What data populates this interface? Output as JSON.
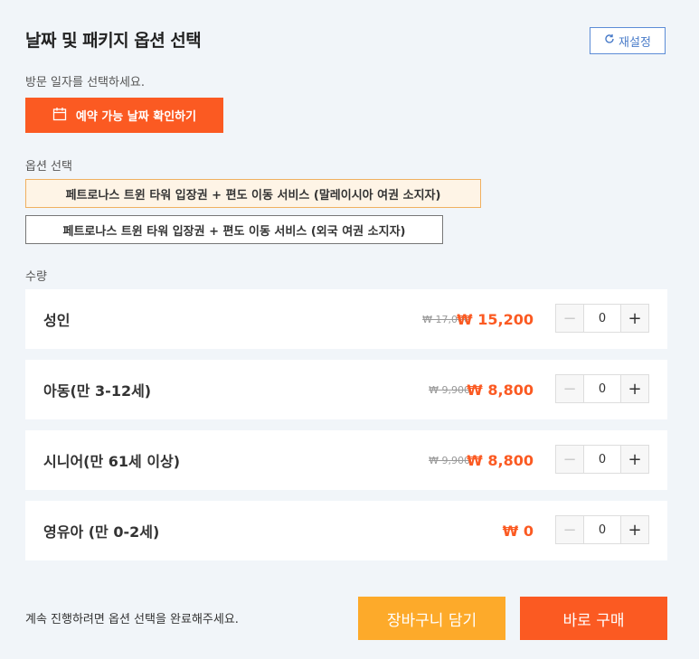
{
  "header": {
    "title": "날짜 및 패키지 옵션 선택",
    "reset_label": "재설정"
  },
  "date": {
    "label": "방문 일자를 선택하세요.",
    "button_label": "예약 가능 날짜 확인하기"
  },
  "options": {
    "label": "옵션 선택",
    "items": [
      {
        "label": "페트로나스 트윈 타워 입장권 + 편도 이동 서비스 (말레이시아 여권 소지자)",
        "selected": true
      },
      {
        "label": "페트로나스 트윈 타워 입장권 + 편도 이동 서비스 (외국 여권 소지자)",
        "selected": false
      }
    ]
  },
  "quantity": {
    "label": "수량",
    "items": [
      {
        "name": "성인",
        "original_price": "₩ 17,000",
        "price": "₩ 15,200",
        "qty": "0"
      },
      {
        "name": "아동(만 3-12세)",
        "original_price": "₩ 9,900",
        "price": "₩ 8,800",
        "qty": "0"
      },
      {
        "name": "시니어(만 61세 이상)",
        "original_price": "₩ 9,900",
        "price": "₩ 8,800",
        "qty": "0"
      },
      {
        "name": "영유아 (만 0-2세)",
        "original_price": "",
        "price": "₩ 0",
        "qty": "0"
      }
    ]
  },
  "footer": {
    "message": "계속 진행하려면 옵션 선택을 완료해주세요.",
    "cart_label": "장바구니 담기",
    "buy_label": "바로 구매"
  },
  "colors": {
    "accent": "#fb5a22",
    "cart": "#fdaa2a",
    "reset": "#4a7cc9"
  }
}
